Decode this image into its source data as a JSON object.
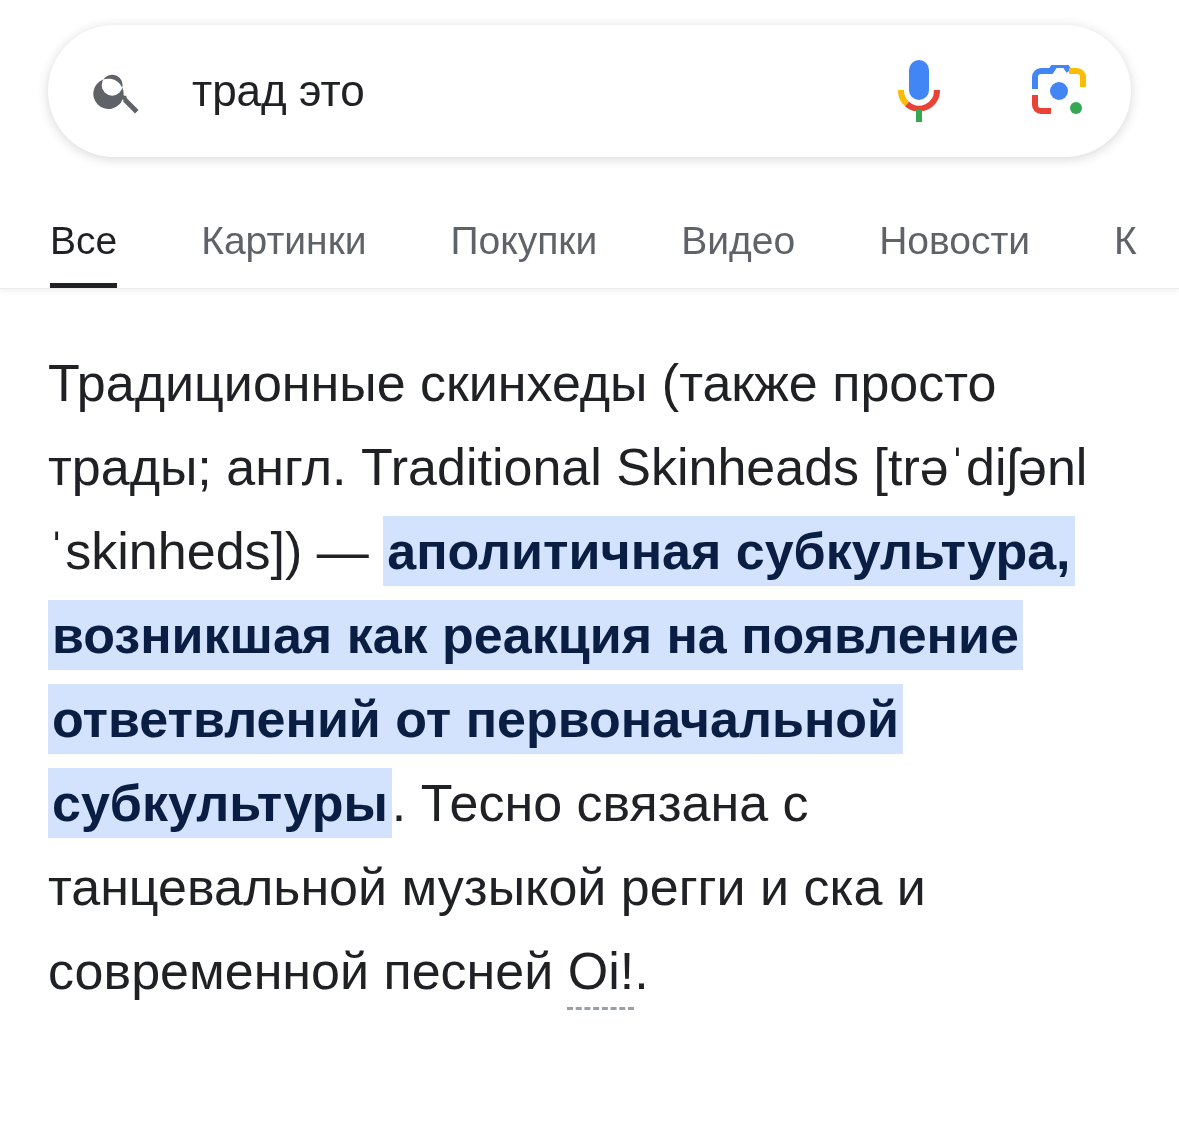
{
  "search": {
    "value": "трад это"
  },
  "tabs": [
    {
      "label": "Все",
      "selected": true
    },
    {
      "label": "Картинки",
      "selected": false
    },
    {
      "label": "Покупки",
      "selected": false
    },
    {
      "label": "Видео",
      "selected": false
    },
    {
      "label": "Новости",
      "selected": false
    },
    {
      "label": "К",
      "selected": false
    }
  ],
  "snippet": {
    "segments": [
      {
        "kind": "text",
        "text": "Традиционные скинхеды (также просто трады; англ. Traditional Skinheads [trəˈdiʃənl ˈskinheds]) — "
      },
      {
        "kind": "highlight",
        "text": "аполитичная субкультура, возникшая как реакция на появление ответвлений от первоначальной субкультуры"
      },
      {
        "kind": "text",
        "text": ". Тесно связана с танцевальной музыкой регги и ска и современной песней "
      },
      {
        "kind": "link",
        "text": "Oi!"
      },
      {
        "kind": "text",
        "text": "."
      }
    ]
  }
}
